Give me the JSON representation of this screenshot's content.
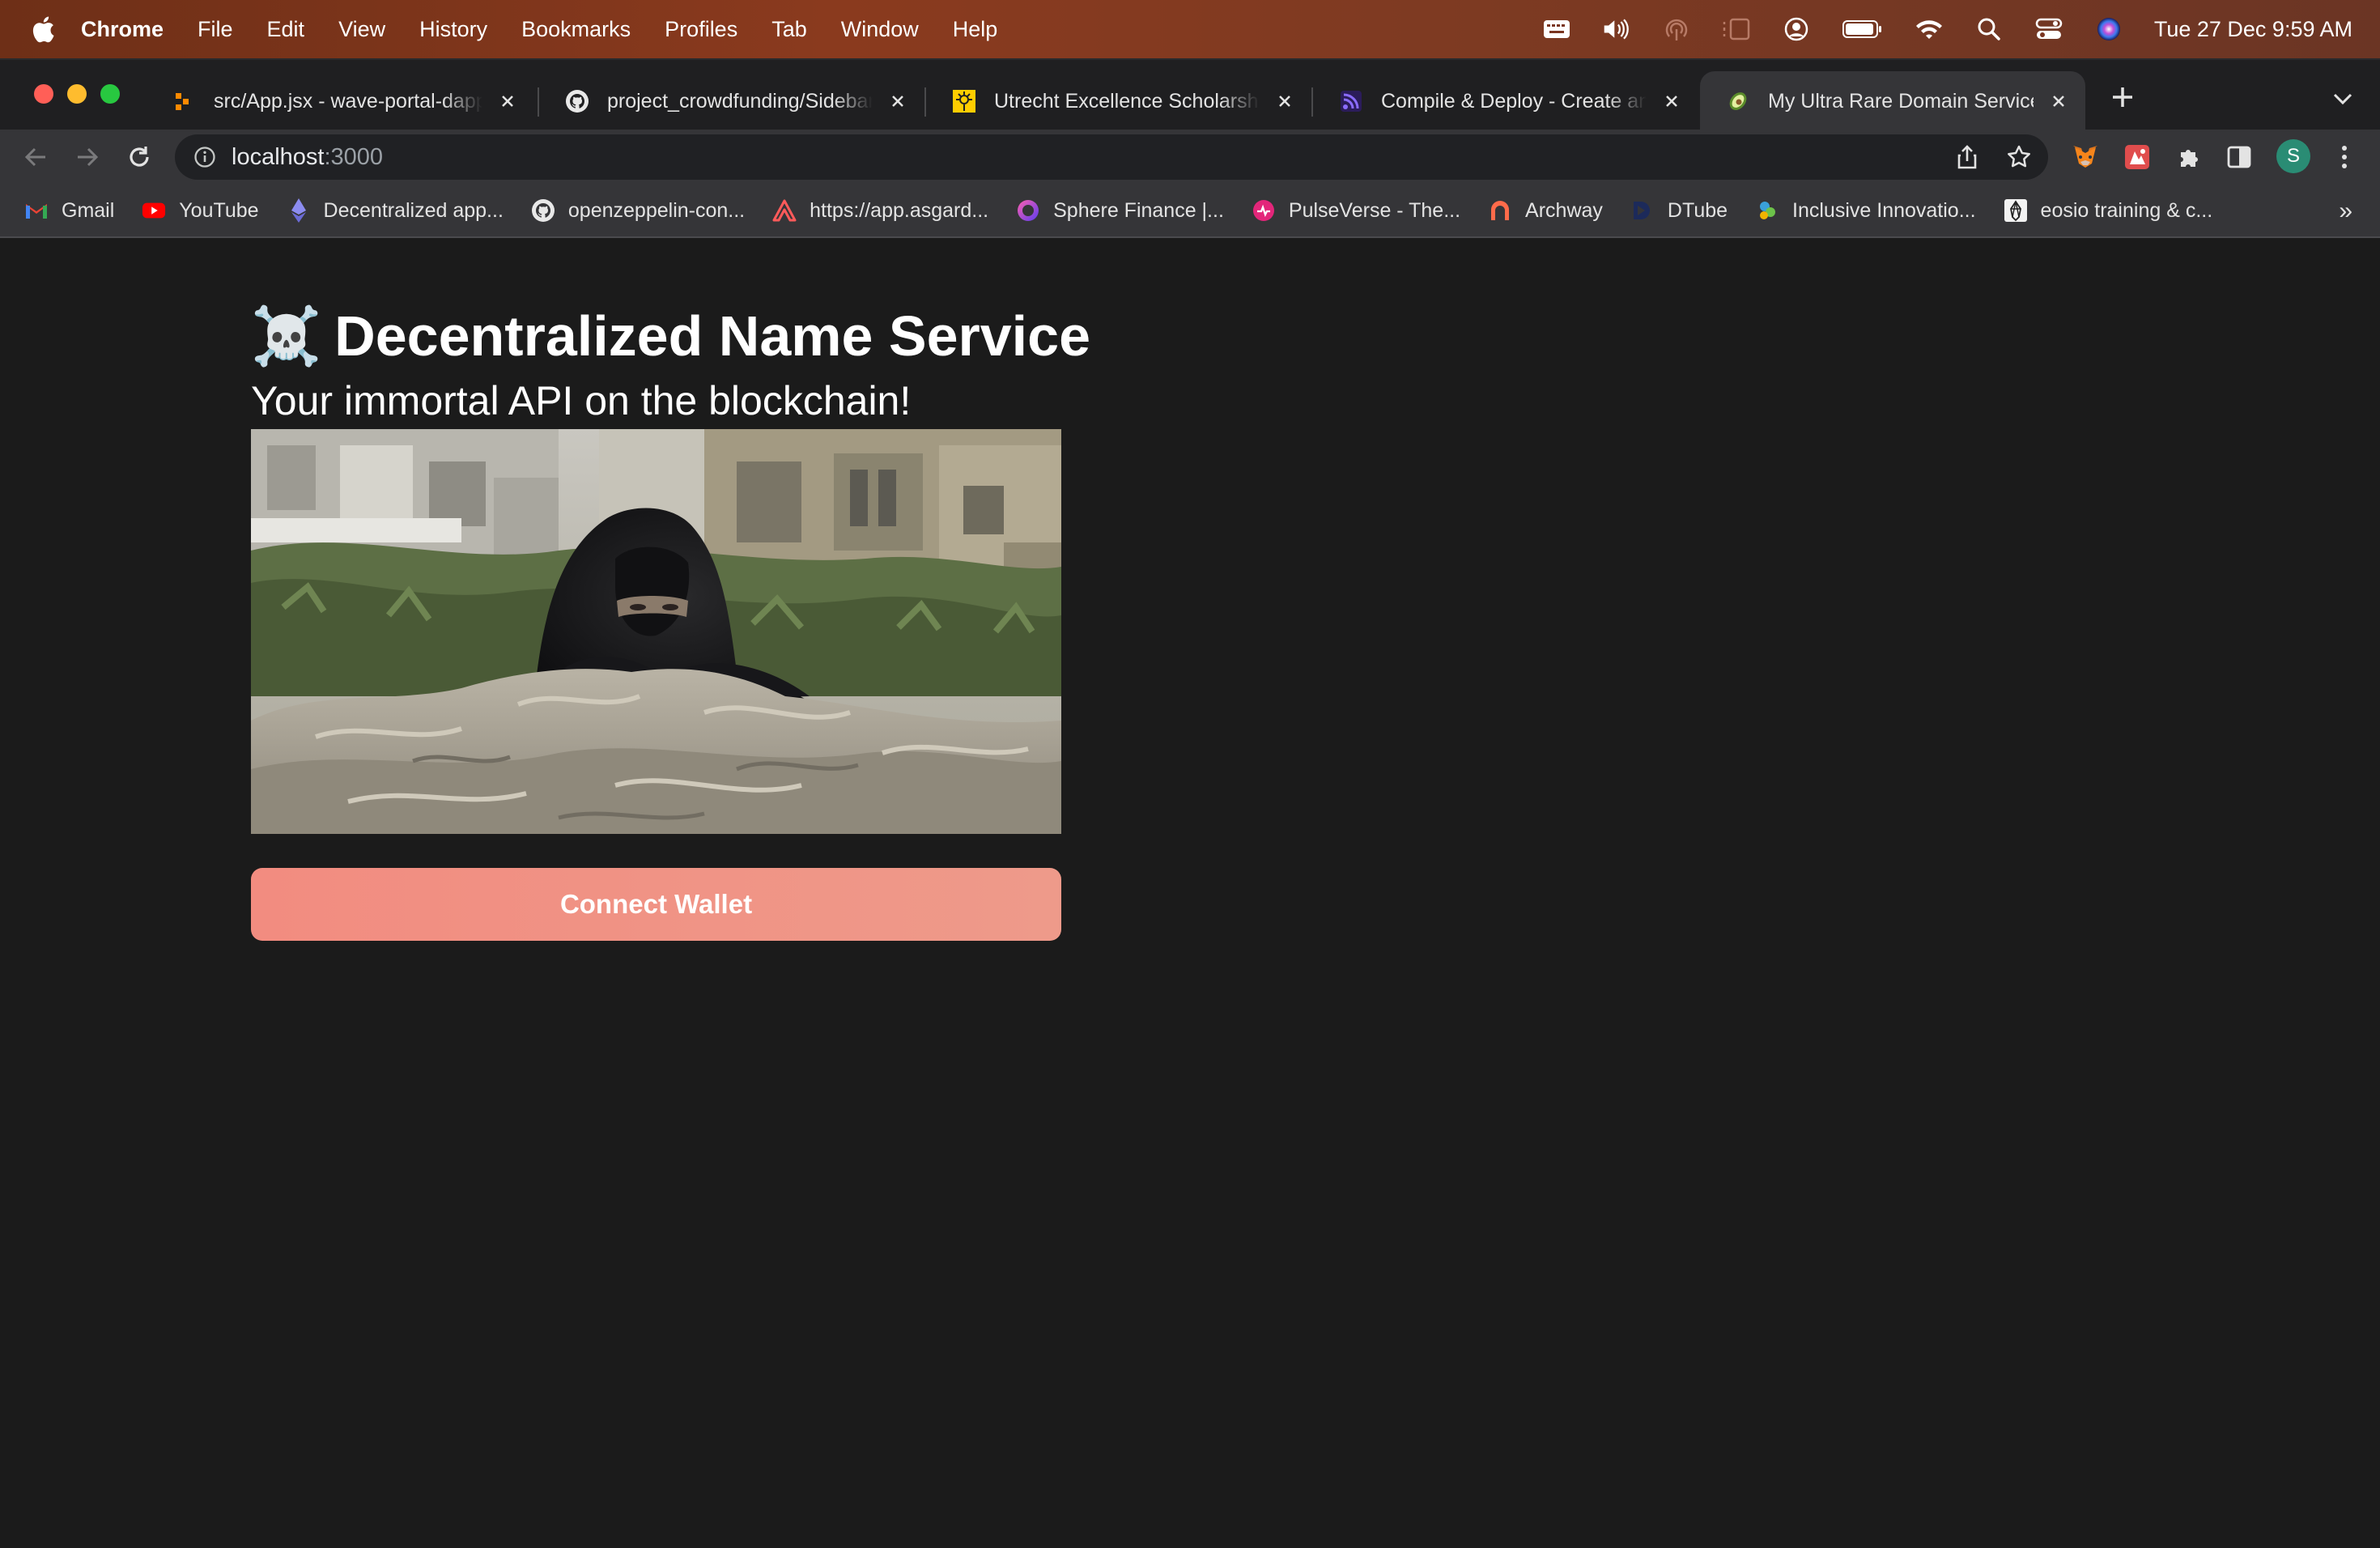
{
  "menubar": {
    "app_name": "Chrome",
    "items": [
      "File",
      "Edit",
      "View",
      "History",
      "Bookmarks",
      "Profiles",
      "Tab",
      "Window",
      "Help"
    ],
    "clock": "Tue 27 Dec  9:59 AM"
  },
  "tabs": [
    {
      "title": "src/App.jsx - wave-portal-dapp",
      "icon": "gitpod-icon",
      "active": false
    },
    {
      "title": "project_crowdfunding/Sidebar.",
      "icon": "github-icon",
      "active": false
    },
    {
      "title": "Utrecht Excellence Scholarship",
      "icon": "utrecht-icon",
      "active": false
    },
    {
      "title": "Compile & Deploy - Create an N",
      "icon": "rss-icon",
      "active": false
    },
    {
      "title": "My Ultra Rare Domain Service",
      "icon": "avocado-icon",
      "active": true
    }
  ],
  "address_bar": {
    "host": "localhost",
    "port": ":3000"
  },
  "profile_initial": "S",
  "bookmarks": [
    {
      "label": "Gmail",
      "icon": "gmail-icon"
    },
    {
      "label": "YouTube",
      "icon": "youtube-icon"
    },
    {
      "label": "Decentralized app...",
      "icon": "ethereum-icon"
    },
    {
      "label": "openzeppelin-con...",
      "icon": "github-icon"
    },
    {
      "label": "https://app.asgard...",
      "icon": "asgard-icon"
    },
    {
      "label": "Sphere Finance |...",
      "icon": "sphere-icon"
    },
    {
      "label": "PulseVerse - The...",
      "icon": "pulse-icon"
    },
    {
      "label": "Archway",
      "icon": "archway-icon"
    },
    {
      "label": "DTube",
      "icon": "dtube-icon"
    },
    {
      "label": "Inclusive Innovatio...",
      "icon": "inclusive-icon"
    },
    {
      "label": "eosio training & c...",
      "icon": "eosio-icon"
    }
  ],
  "bookmarks_overflow": "»",
  "page": {
    "title_emoji": "☠️",
    "title": "Decentralized Name Service",
    "subtitle": "Your immortal API on the blockchain!",
    "connect_button": "Connect Wallet"
  },
  "colors": {
    "page_background": "#1b1b1b",
    "button_start": "#f28c80",
    "button_end": "#ee9a8a"
  }
}
